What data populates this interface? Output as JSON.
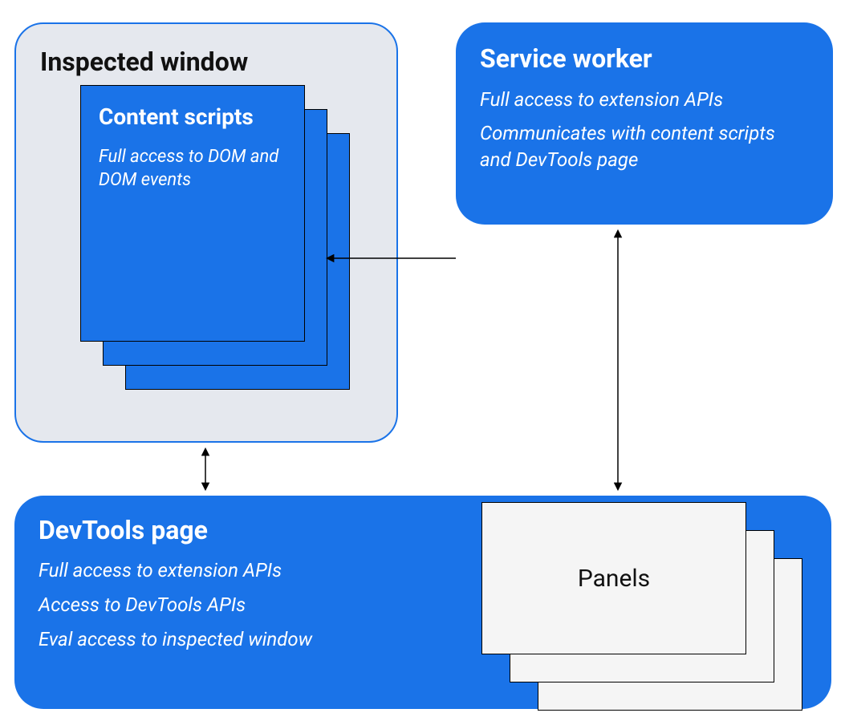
{
  "inspected_window": {
    "title": "Inspected window",
    "content_scripts": {
      "title": "Content scripts",
      "desc": "Full access to DOM and DOM events"
    }
  },
  "service_worker": {
    "title": "Service worker",
    "line1": "Full access to extension APIs",
    "line2": "Communicates with content scripts and DevTools page"
  },
  "devtools_page": {
    "title": "DevTools page",
    "line1": "Full access to extension APIs",
    "line2": "Access to DevTools APIs",
    "line3": "Eval access to inspected window"
  },
  "panels": {
    "label": "Panels"
  }
}
